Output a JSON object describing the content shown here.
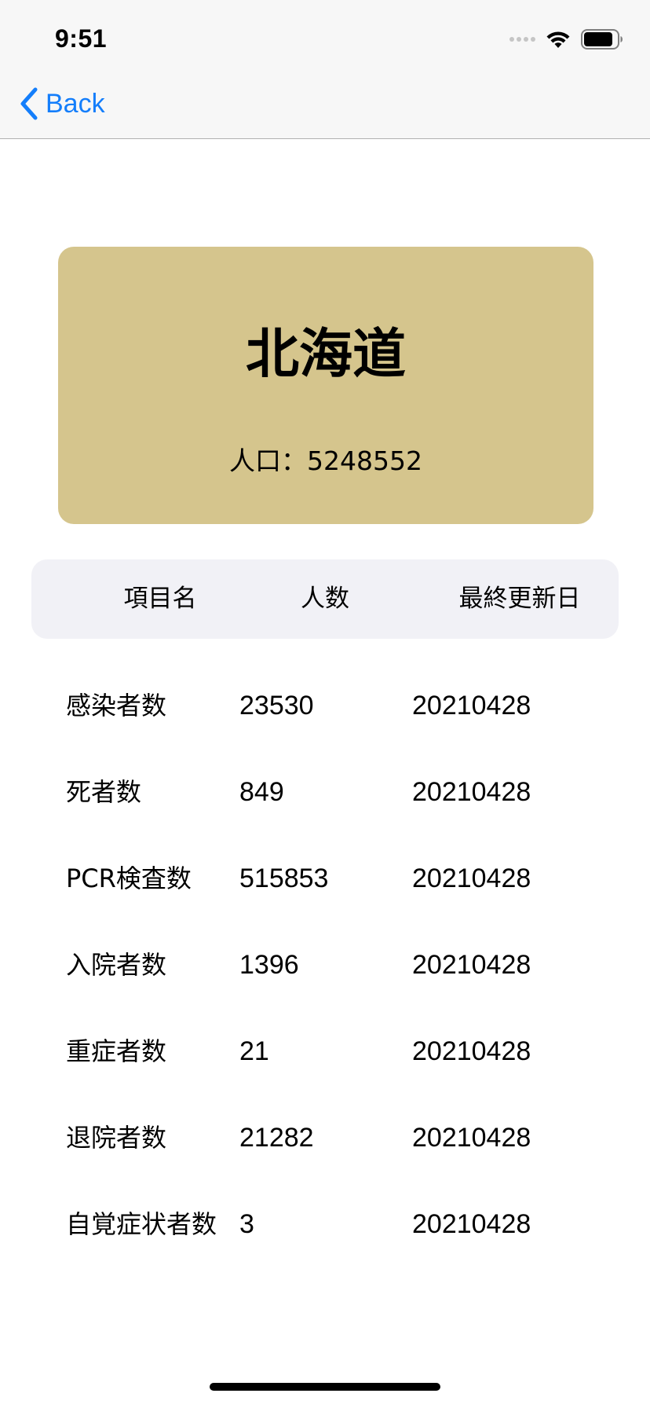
{
  "status_bar": {
    "time": "9:51"
  },
  "nav": {
    "back_label": "Back",
    "accent_color": "#147efb"
  },
  "prefecture": {
    "name": "北海道",
    "population_label": "人口：5248552",
    "card_color": "#d5c58d"
  },
  "table": {
    "headers": [
      "項目名",
      "人数",
      "最終更新日"
    ],
    "rows": [
      {
        "item": "感染者数",
        "count": "23530",
        "date": "20210428"
      },
      {
        "item": "死者数",
        "count": "849",
        "date": "20210428"
      },
      {
        "item": "PCR検査数",
        "count": "515853",
        "date": "20210428"
      },
      {
        "item": "入院者数",
        "count": "1396",
        "date": "20210428"
      },
      {
        "item": "重症者数",
        "count": "21",
        "date": "20210428"
      },
      {
        "item": "退院者数",
        "count": "21282",
        "date": "20210428"
      },
      {
        "item": "自覚症状者数",
        "count": "3",
        "date": "20210428"
      }
    ]
  }
}
